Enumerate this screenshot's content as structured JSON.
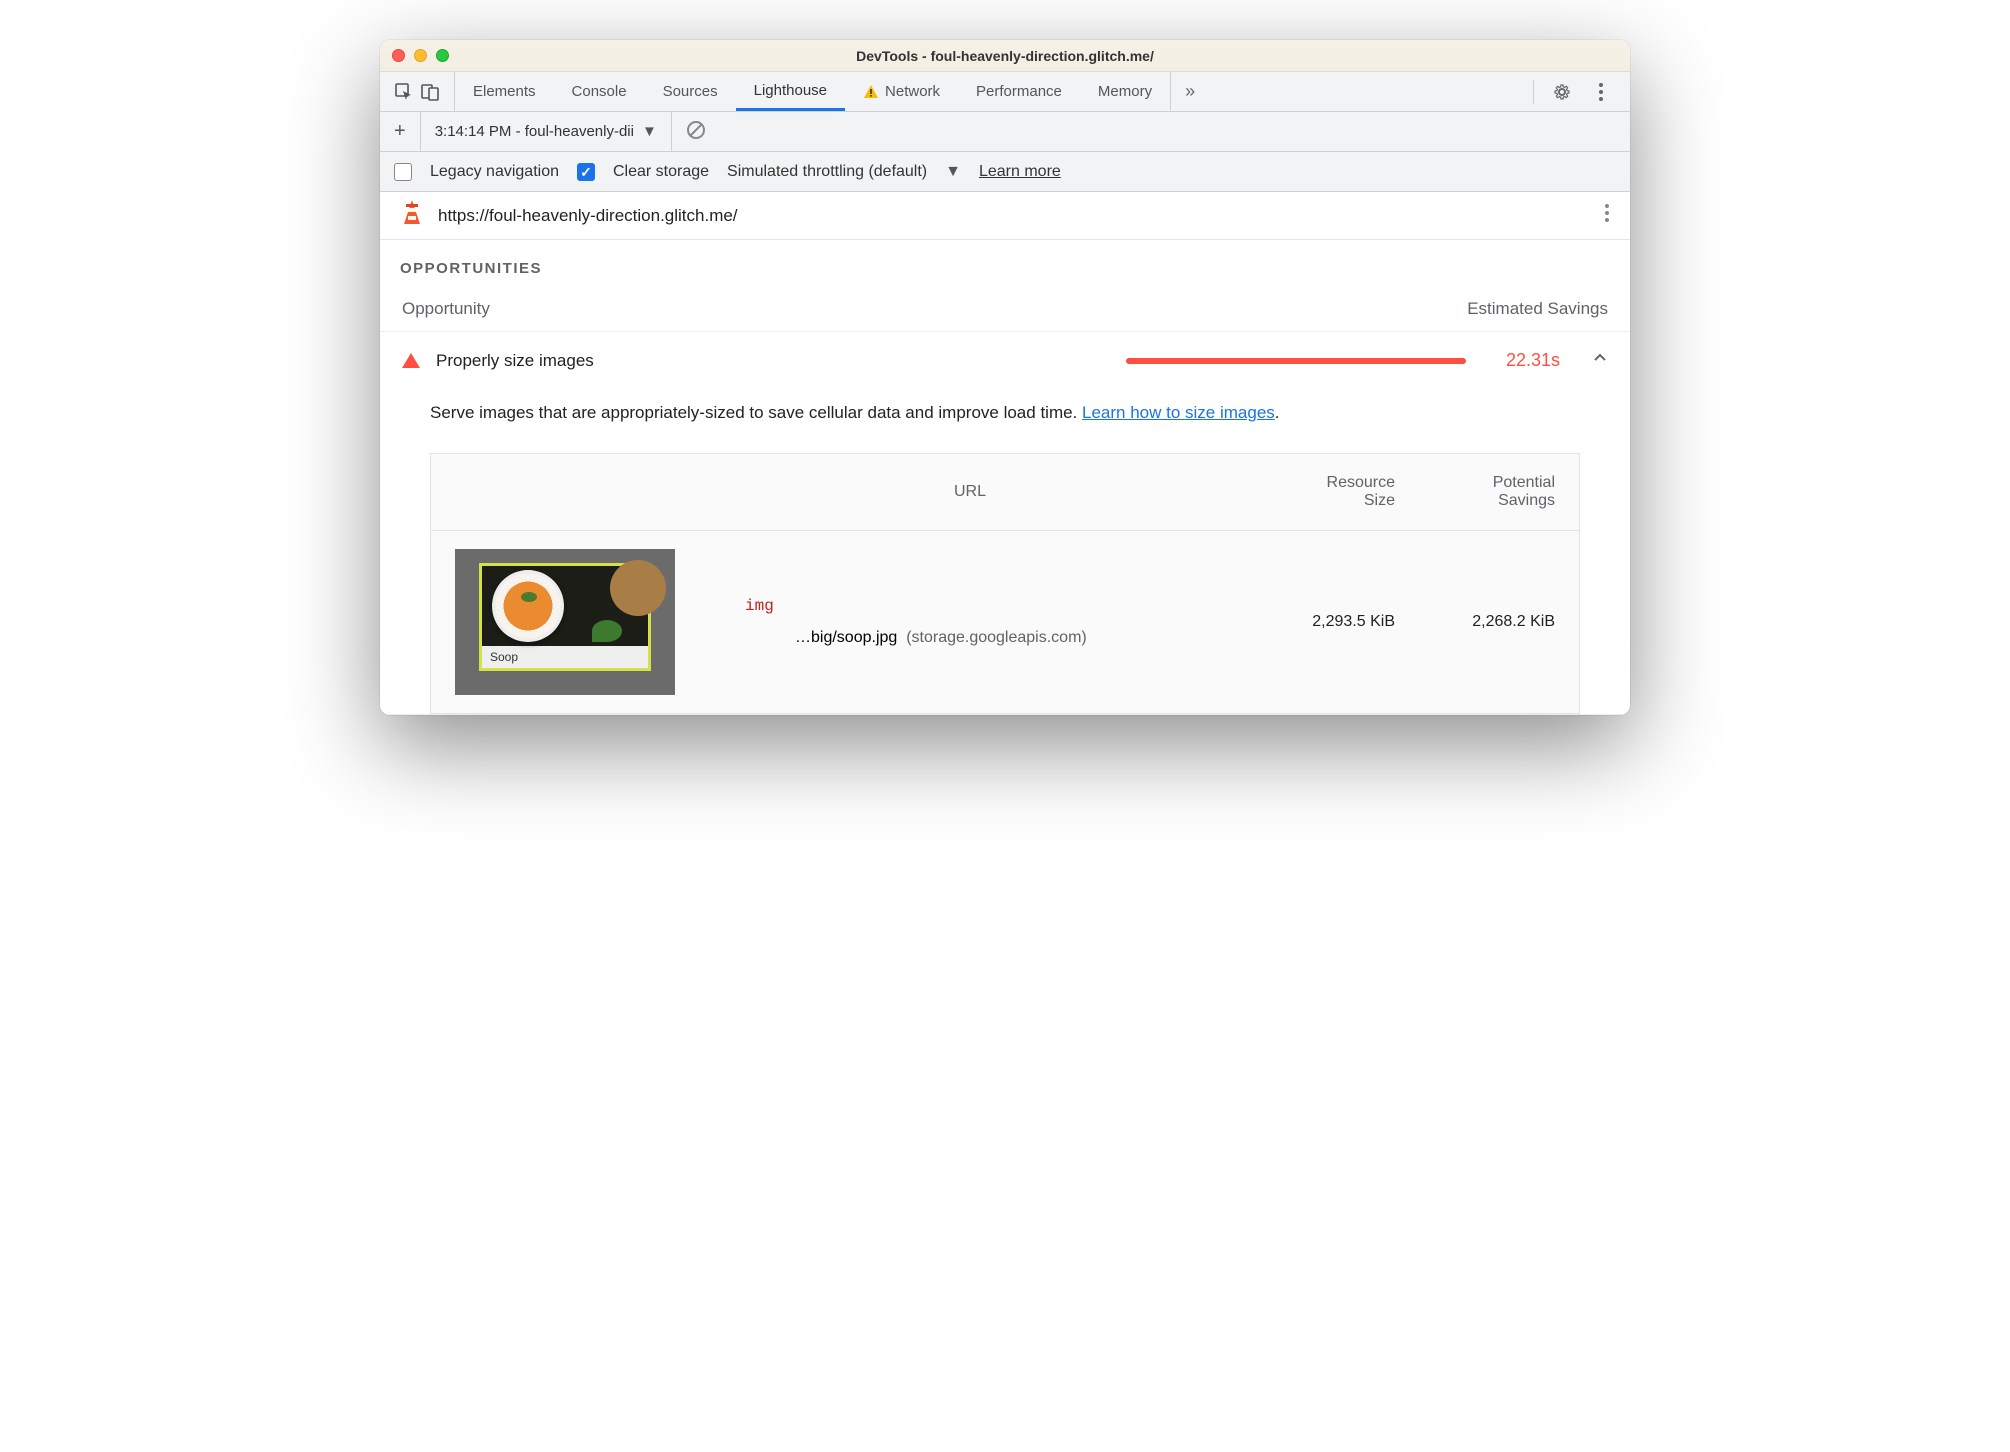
{
  "window": {
    "title": "DevTools - foul-heavenly-direction.glitch.me/"
  },
  "tabs": {
    "items": [
      "Elements",
      "Console",
      "Sources",
      "Lighthouse",
      "Network",
      "Performance",
      "Memory"
    ],
    "active": "Lighthouse"
  },
  "toolbar2": {
    "run_label": "3:14:14 PM - foul-heavenly-dii"
  },
  "options": {
    "legacy_label": "Legacy navigation",
    "clear_label": "Clear storage",
    "throttle_label": "Simulated throttling (default)",
    "learn_more": "Learn more"
  },
  "urlrow": {
    "url": "https://foul-heavenly-direction.glitch.me/"
  },
  "section": {
    "title": "OPPORTUNITIES",
    "col_opportunity": "Opportunity",
    "col_savings": "Estimated Savings"
  },
  "audit": {
    "title": "Properly size images",
    "savings": "22.31s",
    "desc_pre": "Serve images that are appropriately-sized to save cellular data and improve load time. ",
    "desc_link": "Learn how to size images",
    "desc_post": "."
  },
  "table": {
    "h_url": "URL",
    "h_size": "Resource Size",
    "h_savings": "Potential Savings",
    "rows": [
      {
        "tag": "img",
        "path": "…big/soop.jpg",
        "host": "(storage.googleapis.com)",
        "size": "2,293.5 KiB",
        "savings": "2,268.2 KiB",
        "caption": "Soop"
      }
    ]
  }
}
